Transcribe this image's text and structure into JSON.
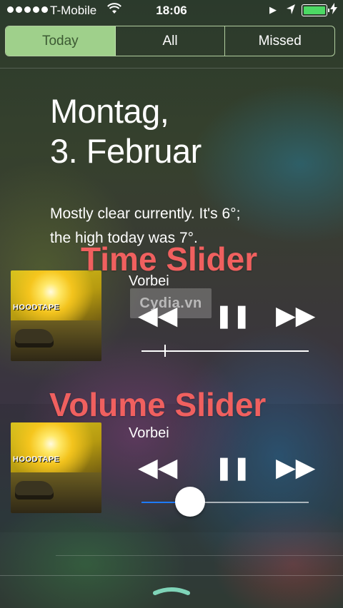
{
  "status_bar": {
    "carrier": "T-Mobile",
    "time": "18:06",
    "battery_level": 1.0,
    "icons": [
      "signal-dots",
      "wifi-icon",
      "play-icon",
      "location-arrow-icon",
      "battery-icon",
      "charging-bolt-icon"
    ]
  },
  "tabs": [
    {
      "label": "Today",
      "selected": true
    },
    {
      "label": "All",
      "selected": false
    },
    {
      "label": "Missed",
      "selected": false
    }
  ],
  "today": {
    "day": "Montag,",
    "date": "3. Februar",
    "weather_line1": "Mostly clear currently. It's 6°;",
    "weather_line2": "the high today was 7°."
  },
  "annotations": {
    "time_slider": "Time Slider",
    "volume_slider": "Volume Slider"
  },
  "watermark": "Cydia.vn",
  "players": [
    {
      "track": "Vorbei",
      "cover_text": "HOODTAPE",
      "time_position": 0.14
    },
    {
      "track": "Vorbei",
      "cover_text": "HOODTAPE",
      "volume_level": 0.29
    }
  ],
  "controls": {
    "rewind": "◀◀",
    "pause": "❚❚",
    "forward": "▶▶"
  },
  "colors": {
    "accent_tab": "#9fd08b",
    "annotation": "#f0605f",
    "volume_fill": "#1e7bff",
    "grabber": "#7fd4b8"
  }
}
